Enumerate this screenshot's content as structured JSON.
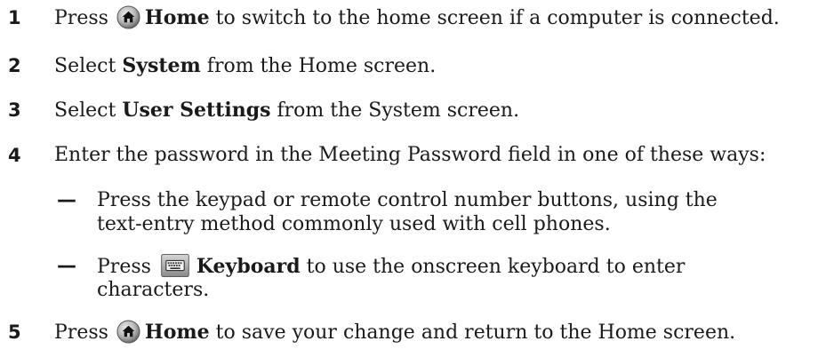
{
  "steps": [
    {
      "number": "1",
      "pre": "Press",
      "icon": "home-icon",
      "bold": "Home",
      "post": " to switch to the home screen if a computer is connected."
    },
    {
      "number": "2",
      "pre": "Select ",
      "bold": "System",
      "post": " from the Home screen."
    },
    {
      "number": "3",
      "pre": "Select ",
      "bold": "User Settings",
      "post": " from the System screen."
    },
    {
      "number": "4",
      "text": "Enter the password in the Meeting Password field in one of these ways:",
      "subitems": [
        {
          "dash": "—",
          "line1": "Press the keypad or remote control number buttons, using the",
          "line2": "text-entry method commonly used with cell phones."
        },
        {
          "dash": "—",
          "pre": "Press",
          "icon": "keyboard-icon",
          "bold": "Keyboard",
          "post": " to use the onscreen keyboard to enter",
          "line2": "characters."
        }
      ]
    },
    {
      "number": "5",
      "pre": "Press",
      "icon": "home-icon",
      "bold": "Home",
      "post": " to save your change and return to the Home screen."
    }
  ],
  "colors": {
    "text": "#1a1a1a",
    "home_icon_fill": "#b8b8b8",
    "keyboard_icon_fill": "#8f8f8f"
  }
}
